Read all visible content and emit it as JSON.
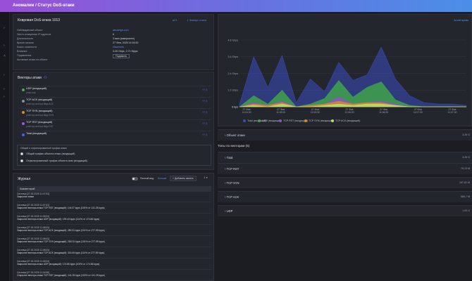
{
  "header": {
    "title": "Аномалии / Статус DoS-атаки"
  },
  "attack_panel": {
    "title": "Ковровая DoS-атака 1013",
    "top_links": {
      "left": "ACL",
      "right": "Экспорт отчета"
    },
    "fields": [
      {
        "label": "Наблюдаемый объект",
        "value": "abcdefgh.com"
      },
      {
        "label": "Число атакуемых IP адресов",
        "value": "6"
      },
      {
        "label": "Длительность",
        "value": "3 мин (завершено)"
      },
      {
        "label": "Время начала",
        "value": "27 Фев, 2025 11:04:50"
      },
      {
        "label": "Класс опасности",
        "value": "Изменить"
      },
      {
        "label": "Влияние",
        "value": "3.25 Gbps, 2.71 Mpps"
      },
      {
        "label": "Подавление",
        "value": "Подавить"
      },
      {
        "label": "Активные атаки на объект",
        "value": ""
      }
    ]
  },
  "vectors_panel": {
    "title": "Векторы атаки",
    "vectors": [
      {
        "name": "UDP (входящий)",
        "sub": "proto udp",
        "color": "#4aa84a"
      },
      {
        "name": "TCP ACK (входящий)",
        "sub": "proto tcp and tcp-flags ACK",
        "color": "#8a8e99"
      },
      {
        "name": "TCP SYN (входящий)",
        "sub": "proto tcp and tcp-flags SYN",
        "color": "#d98a2b"
      },
      {
        "name": "TCP RST (входящий)",
        "sub": "proto tcp and tcp-flags RST",
        "color": "#9b59d0"
      },
      {
        "name": "Total (входящий)",
        "sub": "",
        "color": "#4a5ee8"
      }
    ],
    "options_title": "Общий и отфильтрованный трафик атаки",
    "options": [
      "Общий трафик объекта атаки (входящий)",
      "Отфильтрованный трафик объекта атак (входящий)"
    ]
  },
  "journal_panel": {
    "title": "Журнал",
    "full_view": "Полный вид",
    "more": "Больше",
    "add_button": "Добавить запись",
    "column": "Комментарий",
    "entries": [
      {
        "t": "Система [27.02.2025 11:07:51]",
        "d": "Закрытие атаки"
      },
      {
        "t": "Система [27.02.2025 11:07:51]",
        "d": "Закрытие вектора атаки TCP RST (входящий): 144.07 kpps (100% от 141.25 kpps)"
      },
      {
        "t": "Система [27.02.2025 11:06:51]",
        "d": "Закрытие вектора атаки UDP (входящий): 199.43 kpps (114% от 174.86 kpps)"
      },
      {
        "t": "Система [27.02.2025 11:06:51]",
        "d": "Закрытие вектора атаки TCP ACK (входящий): 280.31 kpps (101% от 277.59 kpps)"
      },
      {
        "t": "Система [27.02.2025 11:06:51]",
        "d": "Закрытие вектора атаки TCP SYN (входящий): 280.31 kpps (101% от 277.59 kpps)"
      },
      {
        "t": "Система [27.02.2025 11:06:51]",
        "d": "Закрытие вектора атаки TCP ACK (входящий): 316.45 kpps (114% от 277.59 kpps)"
      },
      {
        "t": "Система [27.02.2025 11:05:51]",
        "d": "Закрытие вектора атаки UDP (входящий): 174.86 kpps (100% от 174.86 kpps)"
      },
      {
        "t": "Система [27.02.2025 11:04:50]",
        "d": "Открытие вектора атаки TCP RST (входящий): 141.25 kpps (100% от 141.25 kpps)"
      }
    ]
  },
  "chart_link": "За всё время",
  "chart_data": {
    "type": "area",
    "yticks": [
      "0 bps",
      "1.2 Gbps",
      "2.4 Gbps",
      "3.6 Gbps",
      "4.8 Gbps"
    ],
    "ylim": [
      0,
      4.8
    ],
    "x": [
      "27 Фев 11:04:30",
      "27 Фев 11:05:00",
      "27 Фев 11:05:30",
      "27 Фев 11:06:00",
      "27 Фев 11:06:30",
      "27 Фев 11:07:00",
      "27 Фев 11:07:30"
    ],
    "series": [
      {
        "name": "Total (входящий)",
        "color": "#3a4cc0",
        "values": [
          0.2,
          3.6,
          1.4,
          3.7,
          0.3,
          2.0,
          1.1,
          3.2,
          1.9,
          2.3,
          4.3,
          2.0,
          0.8,
          0.3,
          0.2,
          0.2,
          0.1
        ]
      },
      {
        "name": "UDP (входящий)",
        "color": "#3fa34a",
        "values": [
          0.0,
          0.8,
          0.2,
          1.2,
          0.0,
          0.2,
          0.6,
          1.9,
          0.7,
          1.4,
          1.8,
          0.5,
          0.1,
          0.0,
          0.0,
          0.0,
          0.0
        ]
      },
      {
        "name": "TCP RST (входящий)",
        "color": "#8e55c9",
        "values": [
          0.0,
          0.3,
          0.1,
          0.4,
          0.0,
          0.1,
          0.2,
          0.7,
          0.2,
          0.3,
          0.4,
          0.2,
          0.0,
          0.0,
          0.0,
          0.0,
          0.0
        ]
      },
      {
        "name": "TCP SYN (входящий)",
        "color": "#d98a2b",
        "values": [
          0.0,
          0.2,
          0.1,
          0.3,
          0.0,
          0.1,
          0.2,
          0.4,
          0.2,
          0.3,
          0.3,
          0.1,
          0.0,
          0.0,
          0.0,
          0.0,
          0.0
        ]
      },
      {
        "name": "TCP ACK (входящий)",
        "color": "#b7e06a",
        "values": [
          0.0,
          0.1,
          0.0,
          0.2,
          0.0,
          0.0,
          0.1,
          0.2,
          0.1,
          0.2,
          0.2,
          0.1,
          0.0,
          0.0,
          0.0,
          0.0,
          0.0
        ]
      }
    ],
    "legend": [
      "Total (входящий)",
      "UDP (входящий)",
      "TCP RST (входящий)",
      "TCP SYN (входящий)",
      "TCP ACK (входящий)"
    ]
  },
  "right_rows": [
    {
      "label": "Объект атаки",
      "value": "3.25 G"
    },
    {
      "label": "Топы по векторам (5)",
      "value": ""
    },
    {
      "label": "Total",
      "value": "3.25 G"
    },
    {
      "label": "TCP RST",
      "value": "79.13 M"
    },
    {
      "label": "TCP SYN",
      "value": "197.81 M"
    },
    {
      "label": "TCP ACK",
      "value": "569.7 M"
    },
    {
      "label": "UDP",
      "value": "1.93 G"
    }
  ]
}
